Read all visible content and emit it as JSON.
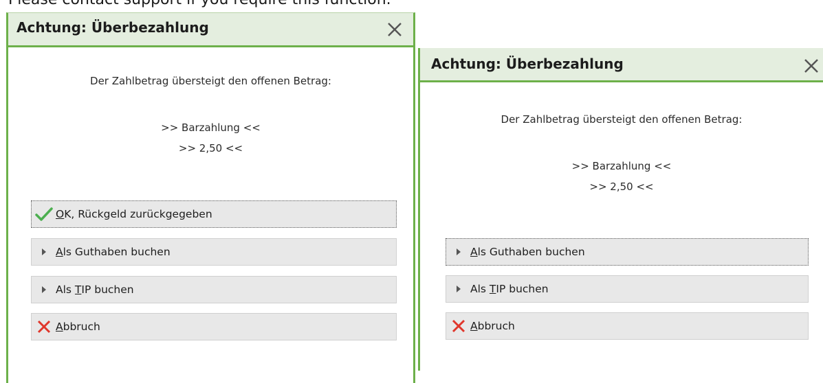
{
  "background_text": "Please contact support if you require this function.",
  "dialog_left": {
    "title": "Achtung: Überbezahlung",
    "message": "Der Zahlbetrag übersteigt den offenen Betrag:",
    "payment_method": ">> Barzahlung <<",
    "amount": ">> 2,50 <<",
    "buttons": {
      "ok": {
        "label": "OK, Rückgeld zurückgegeben",
        "icon": "checkmark-icon"
      },
      "credit": {
        "label": "Als Guthaben buchen",
        "icon": "triangle-right-icon"
      },
      "tip": {
        "label_prefix": "Als ",
        "label_mnemonic": "T",
        "label_suffix": "IP buchen",
        "icon": "triangle-right-icon"
      },
      "cancel": {
        "label": "Abbruch",
        "icon": "cross-icon"
      }
    }
  },
  "dialog_right": {
    "title": "Achtung: Überbezahlung",
    "message": "Der Zahlbetrag übersteigt den offenen Betrag:",
    "payment_method": ">> Barzahlung <<",
    "amount": ">> 2,50 <<",
    "buttons": {
      "credit": {
        "label": "Als Guthaben buchen",
        "icon": "triangle-right-icon"
      },
      "tip": {
        "label_prefix": "Als ",
        "label_mnemonic": "T",
        "label_suffix": "IP buchen",
        "icon": "triangle-right-icon"
      },
      "cancel": {
        "label": "Abbruch",
        "icon": "cross-icon"
      }
    }
  },
  "colors": {
    "accent_green": "#6db04a",
    "title_bg": "#e4eedf",
    "button_bg": "#e8e8e8",
    "check_green": "#4caf50",
    "cross_red": "#e0362b"
  }
}
